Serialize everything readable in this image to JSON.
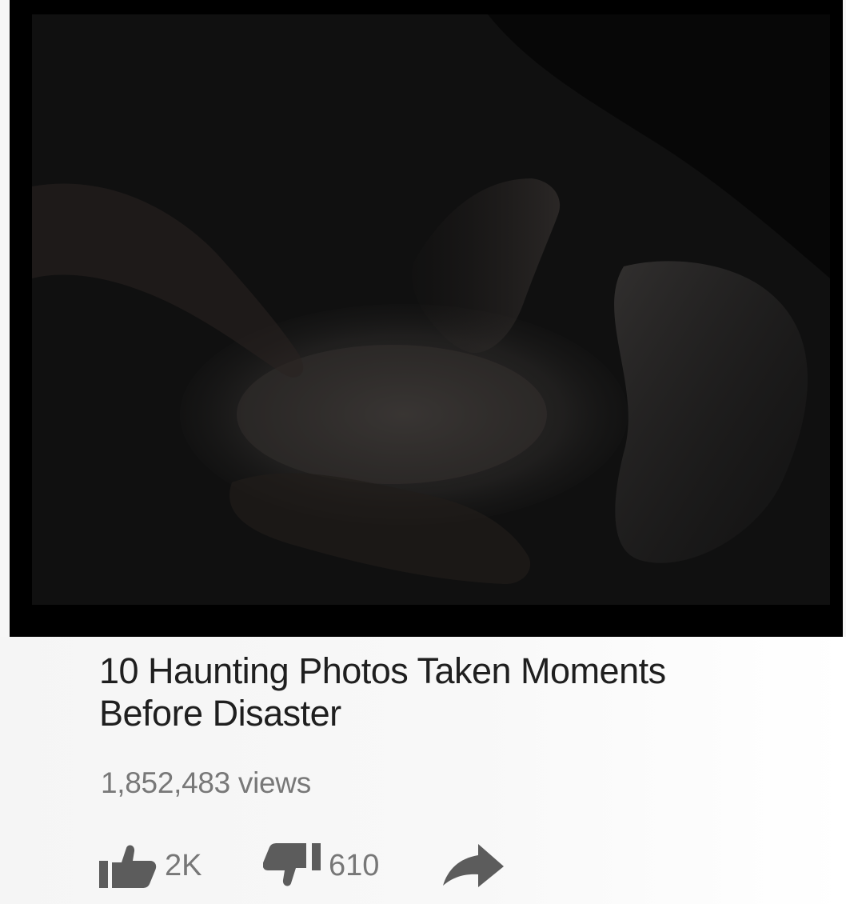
{
  "video": {
    "title": "10 Haunting Photos Taken Moments Before Disaster",
    "views": "1,852,483 views"
  },
  "actions": {
    "like": {
      "icon": "thumbs-up-icon",
      "count": "2K"
    },
    "dislike": {
      "icon": "thumbs-down-icon",
      "count": "610"
    },
    "share": {
      "icon": "share-arrow-icon"
    }
  },
  "colors": {
    "title": "#1f1f1f",
    "secondary_text": "#787878",
    "icon": "#5c5c5c",
    "frame": "#000000"
  }
}
